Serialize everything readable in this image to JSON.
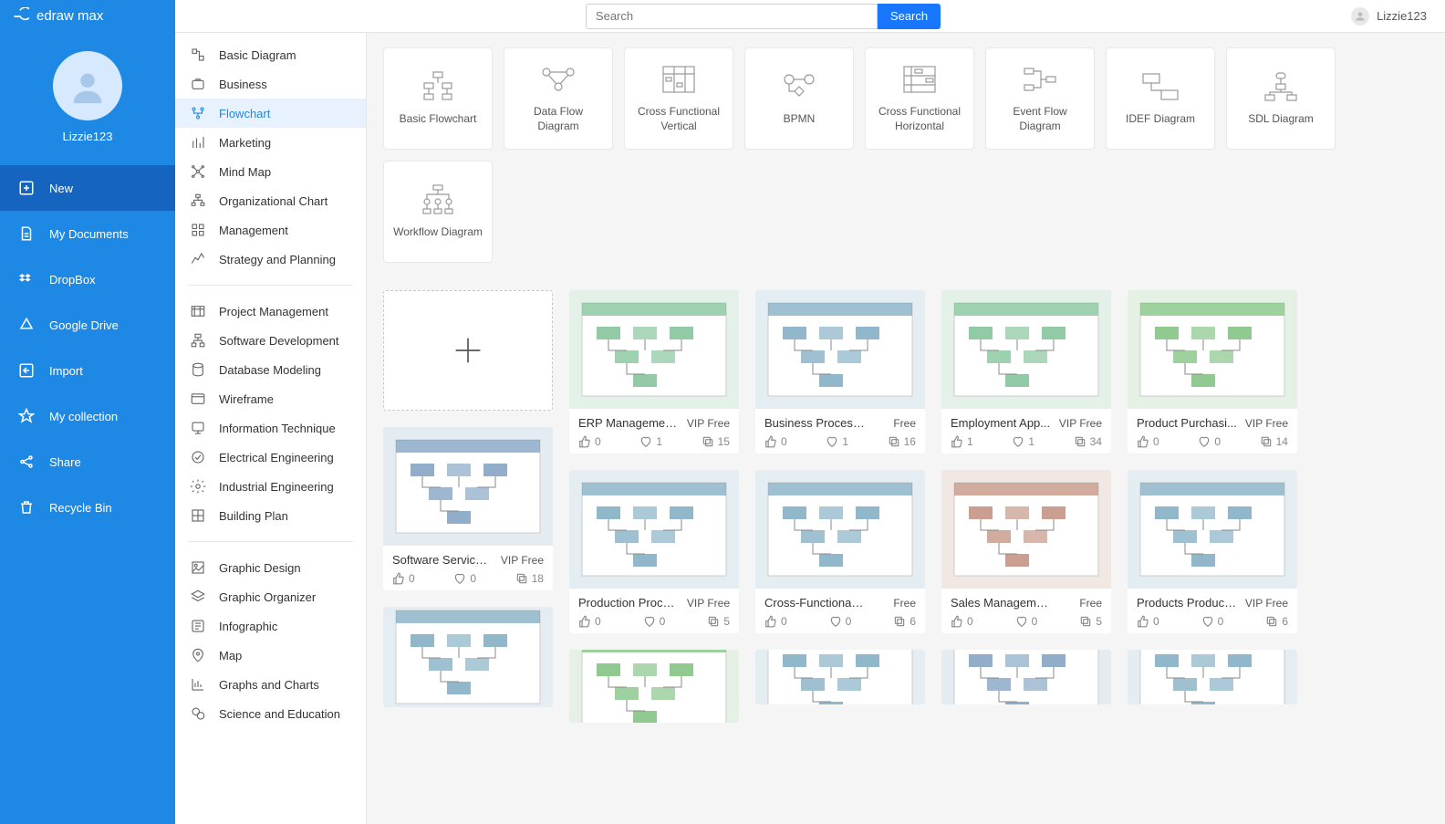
{
  "brand": "edraw max",
  "search": {
    "placeholder": "Search",
    "button": "Search"
  },
  "user": {
    "name": "Lizzie123"
  },
  "profile": {
    "name": "Lizzie123"
  },
  "nav": [
    {
      "id": "new",
      "label": "New",
      "active": true
    },
    {
      "id": "docs",
      "label": "My Documents"
    },
    {
      "id": "dropbox",
      "label": "DropBox"
    },
    {
      "id": "gdrive",
      "label": "Google Drive"
    },
    {
      "id": "import",
      "label": "Import"
    },
    {
      "id": "collection",
      "label": "My collection"
    },
    {
      "id": "share",
      "label": "Share"
    },
    {
      "id": "recycle",
      "label": "Recycle Bin"
    }
  ],
  "categories": {
    "group1": [
      "Basic Diagram",
      "Business",
      "Flowchart",
      "Marketing",
      "Mind Map",
      "Organizational Chart",
      "Management",
      "Strategy and Planning"
    ],
    "activeIndex": 2,
    "group2": [
      "Project Management",
      "Software Development",
      "Database Modeling",
      "Wireframe",
      "Information Technique",
      "Electrical Engineering",
      "Industrial Engineering",
      "Building Plan"
    ],
    "group3": [
      "Graphic Design",
      "Graphic Organizer",
      "Infographic",
      "Map",
      "Graphs and Charts",
      "Science and Education"
    ]
  },
  "types": [
    "Basic Flowchart",
    "Data Flow Diagram",
    "Cross Functional Vertical",
    "BPMN",
    "Cross Functional Horizontal",
    "Event Flow Diagram",
    "IDEF Diagram",
    "SDL Diagram",
    "Workflow Diagram"
  ],
  "templates": [
    {
      "title": "ERP Managemen...",
      "badge": "VIP Free",
      "likes": 0,
      "hearts": 1,
      "copies": 15
    },
    {
      "title": "Business Process Mo...",
      "badge": "Free",
      "likes": 0,
      "hearts": 1,
      "copies": 16
    },
    {
      "title": "Employment App...",
      "badge": "VIP Free",
      "likes": 1,
      "hearts": 1,
      "copies": 34
    },
    {
      "title": "Product Purchasi...",
      "badge": "VIP Free",
      "likes": 0,
      "hearts": 0,
      "copies": 14
    },
    {
      "title": "Software Service ...",
      "badge": "VIP Free",
      "likes": 0,
      "hearts": 0,
      "copies": 18
    },
    {
      "title": "Production Proce...",
      "badge": "VIP Free",
      "likes": 0,
      "hearts": 0,
      "copies": 5
    },
    {
      "title": "Cross-Functional Flo...",
      "badge": "Free",
      "likes": 0,
      "hearts": 0,
      "copies": 6
    },
    {
      "title": "Sales Management C...",
      "badge": "Free",
      "likes": 0,
      "hearts": 0,
      "copies": 5
    },
    {
      "title": "Products Producti...",
      "badge": "VIP Free",
      "likes": 0,
      "hearts": 0,
      "copies": 6
    }
  ]
}
